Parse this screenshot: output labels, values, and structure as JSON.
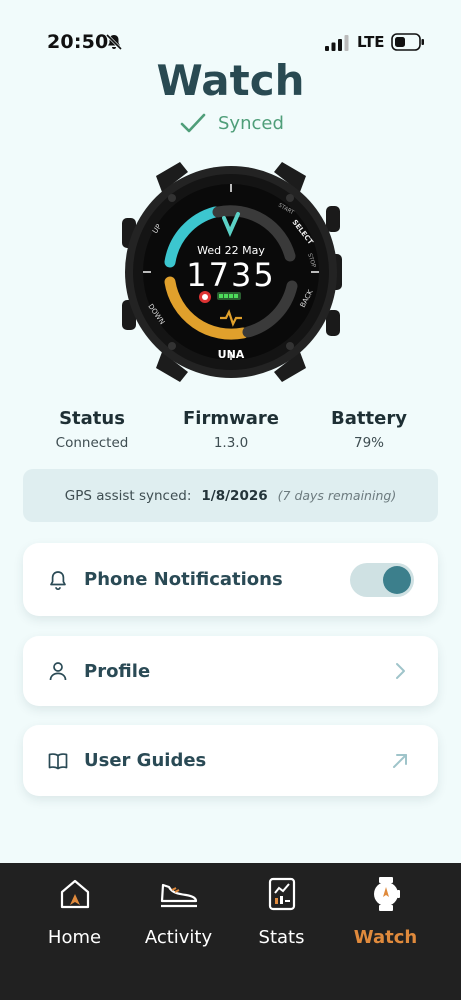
{
  "status_bar": {
    "time": "20:50",
    "network": "LTE",
    "battery_icon": "battery-low-icon"
  },
  "header": {
    "title": "Watch",
    "sync_status": "Synced"
  },
  "watch_face": {
    "date": "Wed 22 May",
    "time": "1735",
    "brand": "UNA",
    "labels": {
      "up": "UP",
      "down": "DOWN",
      "start": "START",
      "select": "SELECT",
      "stop": "STOP",
      "back": "BACK"
    }
  },
  "info": {
    "status": {
      "label": "Status",
      "value": "Connected"
    },
    "firmware": {
      "label": "Firmware",
      "value": "1.3.0"
    },
    "battery": {
      "label": "Battery",
      "value": "79%"
    }
  },
  "gps": {
    "label": "GPS assist synced:",
    "date": "1/8/2026",
    "remaining": "(7 days remaining)"
  },
  "cards": {
    "notifications": {
      "label": "Phone Notifications",
      "icon": "bell-icon",
      "toggle_on": true
    },
    "profile": {
      "label": "Profile",
      "icon": "user-icon"
    },
    "guides": {
      "label": "User Guides",
      "icon": "book-icon"
    }
  },
  "tabs": [
    {
      "label": "Home",
      "icon": "home-icon",
      "active": false
    },
    {
      "label": "Activity",
      "icon": "shoe-icon",
      "active": false
    },
    {
      "label": "Stats",
      "icon": "stats-icon",
      "active": false
    },
    {
      "label": "Watch",
      "icon": "watch-icon",
      "active": true
    }
  ],
  "colors": {
    "accent": "#e08a3c",
    "teal": "#3c7f8c",
    "synced_green": "#4f9e79",
    "background": "#f1fbfb"
  }
}
